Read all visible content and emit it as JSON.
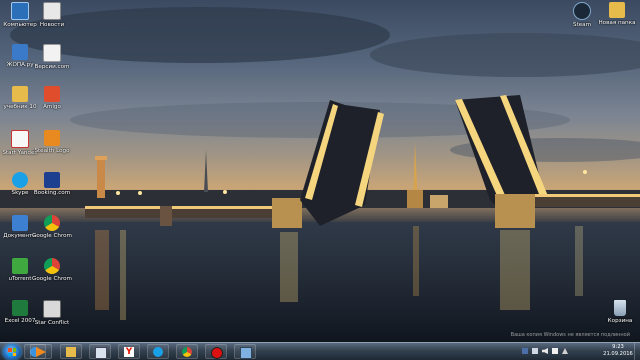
{
  "desktop": {
    "icons": [
      {
        "label": "Компьютер"
      },
      {
        "label": "Новости"
      },
      {
        "label": "ЖОПА.ру"
      },
      {
        "label": "Версии.com"
      },
      {
        "label": "учебник 10"
      },
      {
        "label": "Amigo"
      },
      {
        "label": "Start Yandex"
      },
      {
        "label": "Stealth Logo"
      },
      {
        "label": "Skype"
      },
      {
        "label": "Booking.com"
      },
      {
        "label": "Документы"
      },
      {
        "label": "Google Chrome"
      },
      {
        "label": "uTorrent"
      },
      {
        "label": "Google Chrome"
      },
      {
        "label": "Excel 2007"
      },
      {
        "label": "Star Conflict"
      },
      {
        "label": "Steam"
      },
      {
        "label": "Новая папка"
      },
      {
        "label": "Корзина"
      }
    ]
  },
  "taskbar": {
    "start_button": "Пуск",
    "pinned": [
      "Проводник",
      "Медиаплеер",
      "Библиотеки",
      "Окно",
      "Яндекс",
      "Skype",
      "Google Chrome",
      "Запись",
      "Мой компьютер"
    ],
    "clock_time": "9:23",
    "clock_date": "21.09.2016"
  },
  "watermark": {
    "line1": "Ваша копия Windows не является подлинной"
  },
  "colors": {
    "taskbar": "#33414f",
    "accent": "#1f6fc1"
  }
}
